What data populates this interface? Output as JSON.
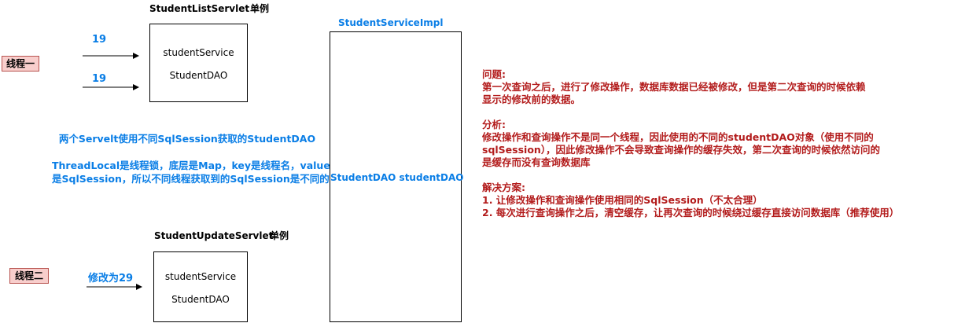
{
  "list_servlet": {
    "title": "StudentListServlet",
    "singleton": "单例",
    "field1": "studentService",
    "field2": "StudentDAO",
    "arrow1_value": "19",
    "arrow2_value": "19"
  },
  "update_servlet": {
    "title": "StudentUpdateServlet",
    "singleton": "单例",
    "field1": "studentService",
    "field2": "StudentDAO",
    "arrow_value": "修改为29"
  },
  "threads": {
    "thread1": "线程一",
    "thread2": "线程二"
  },
  "service_impl": {
    "title": "StudentServiceImpl",
    "field": "StudentDAO studentDAO"
  },
  "notes": {
    "line1": "两个Servelt使用不同SqlSession获取的StudentDAO",
    "line2": "ThreadLocal是线程锁，底层是Map，key是线程名，value",
    "line3": "是SqlSession，所以不同线程获取到的SqlSession是不同的"
  },
  "analysis": {
    "problem_title": "问题:",
    "problem_line1": "第一次查询之后，进行了修改操作，数据库数据已经被修改，但是第二次查询的时候依赖",
    "problem_line2": "显示的修改前的数据。",
    "analysis_title": "分析:",
    "analysis_line1": "修改操作和查询操作不是同一个线程，因此使用的不同的studentDAO对象（使用不同的",
    "analysis_line2": "sqlSession），因此修改操作不会导致查询操作的缓存失效，第二次查询的时候依然访问的",
    "analysis_line3": "是缓存而没有查询数据库",
    "solution_title": "解决方案:",
    "solution_line1": "1. 让修改操作和查询操作使用相同的SqlSession（不太合理）",
    "solution_line2": "2. 每次进行查询操作之后，清空缓存，让再次查询的时候绕过缓存直接访问数据库（推荐使用）"
  },
  "colors": {
    "blue": "#0a7ee6",
    "dark_red": "#b31c1c",
    "thread_fill": "#f8cecc",
    "thread_border": "#b85450"
  }
}
